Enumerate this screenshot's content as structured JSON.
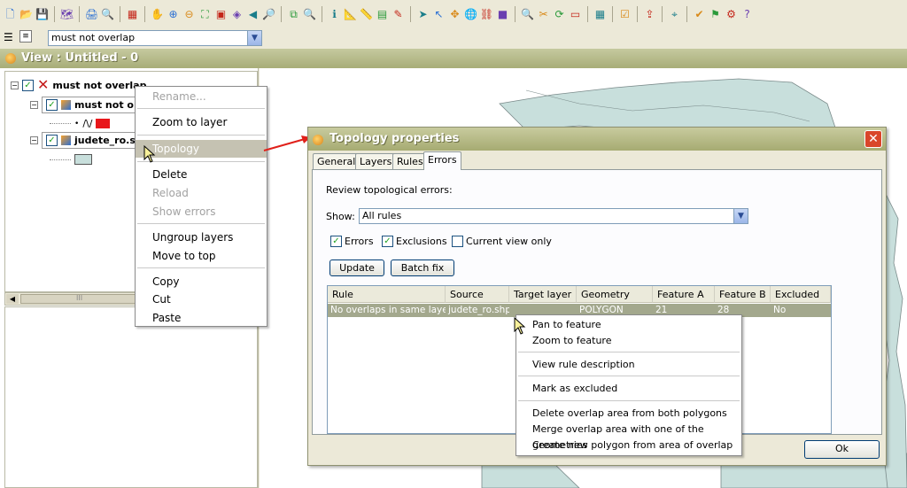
{
  "toolbar": {
    "icons": [
      "new-icon",
      "open-icon",
      "save-icon",
      "sep",
      "layers-icon",
      "sep",
      "print-preview-icon",
      "zoom-page-icon",
      "sep",
      "properties-icon",
      "sep",
      "pan-icon",
      "zoom-in-icon",
      "zoom-out-icon",
      "full-extent-icon",
      "select-icon",
      "layer-stack-icon",
      "back-icon",
      "search-icon",
      "sep",
      "zoom-window-icon",
      "zoom-magnify-icon",
      "sep",
      "info-icon",
      "measure-icon",
      "ruler-icon",
      "table-icon",
      "pencil-icon",
      "sep",
      "pointer-icon",
      "select-arrow-icon",
      "move-icon",
      "globe-icon",
      "link-icon",
      "gray-square-icon",
      "sep",
      "zoom-select-icon",
      "edit-tool-icon",
      "rotate-icon",
      "box-icon",
      "sep",
      "grid-icon",
      "sep",
      "checklist-icon",
      "sep",
      "export-icon",
      "sep",
      "target-icon",
      "sep",
      "validate-icon",
      "error-flag-icon",
      "gear-icon",
      "help-icon"
    ]
  },
  "layer_combo": {
    "value": "must not overlap"
  },
  "view": {
    "title": "View : Untitled - 0"
  },
  "toc": {
    "topology_name": "must not overlap",
    "layer1_name": "must not o",
    "layer2_name": "judete_ro.s",
    "scroll_thumb_label": "III"
  },
  "layer_menu": {
    "items": [
      {
        "label": "Rename...",
        "enabled": false
      },
      {
        "label": "Zoom to layer",
        "enabled": true
      },
      {
        "label": "Topology properties...",
        "enabled": true,
        "highlighted": true
      },
      {
        "label": "Delete",
        "enabled": true
      },
      {
        "label": "Reload",
        "enabled": false
      },
      {
        "label": "Show errors",
        "enabled": false
      },
      {
        "label": "Ungroup layers",
        "enabled": true
      },
      {
        "label": "Move to top",
        "enabled": true
      },
      {
        "label": "Copy",
        "enabled": true
      },
      {
        "label": "Cut",
        "enabled": true
      },
      {
        "label": "Paste",
        "enabled": true
      }
    ]
  },
  "dialog": {
    "title": "Topology properties",
    "tabs": [
      "General",
      "Layers",
      "Rules",
      "Errors"
    ],
    "active_tab": "Errors",
    "review_label": "Review topological errors:",
    "show_label": "Show:",
    "show_value": "All rules",
    "checkboxes": [
      {
        "label": "Errors",
        "checked": true
      },
      {
        "label": "Exclusions",
        "checked": true
      },
      {
        "label": "Current view only",
        "checked": false
      }
    ],
    "update_button": "Update",
    "batch_fix_button": "Batch fix",
    "ok_button": "Ok",
    "table": {
      "columns": [
        "Rule",
        "Source layer",
        "Target layer",
        "Geometry type",
        "Feature A",
        "Feature B",
        "Excluded"
      ],
      "rows": [
        [
          "No overlaps in same layer",
          "judete_ro.shp",
          "",
          "POLYGON",
          "21",
          "28",
          "No"
        ]
      ]
    }
  },
  "row_menu": {
    "items": [
      "Pan to feature",
      "Zoom to feature",
      "View rule description",
      "Mark as excluded",
      "Delete overlap area from both polygons",
      "Merge overlap area with one of the geometries",
      "Create new polygon from area of overlap"
    ]
  },
  "colors": {
    "titlebar": "#a8ad78",
    "selection": "#a3a88d",
    "map_fill": "#c8dfdc",
    "map_stroke": "#7a8a8a",
    "annotation_arrow": "#e0201a"
  }
}
